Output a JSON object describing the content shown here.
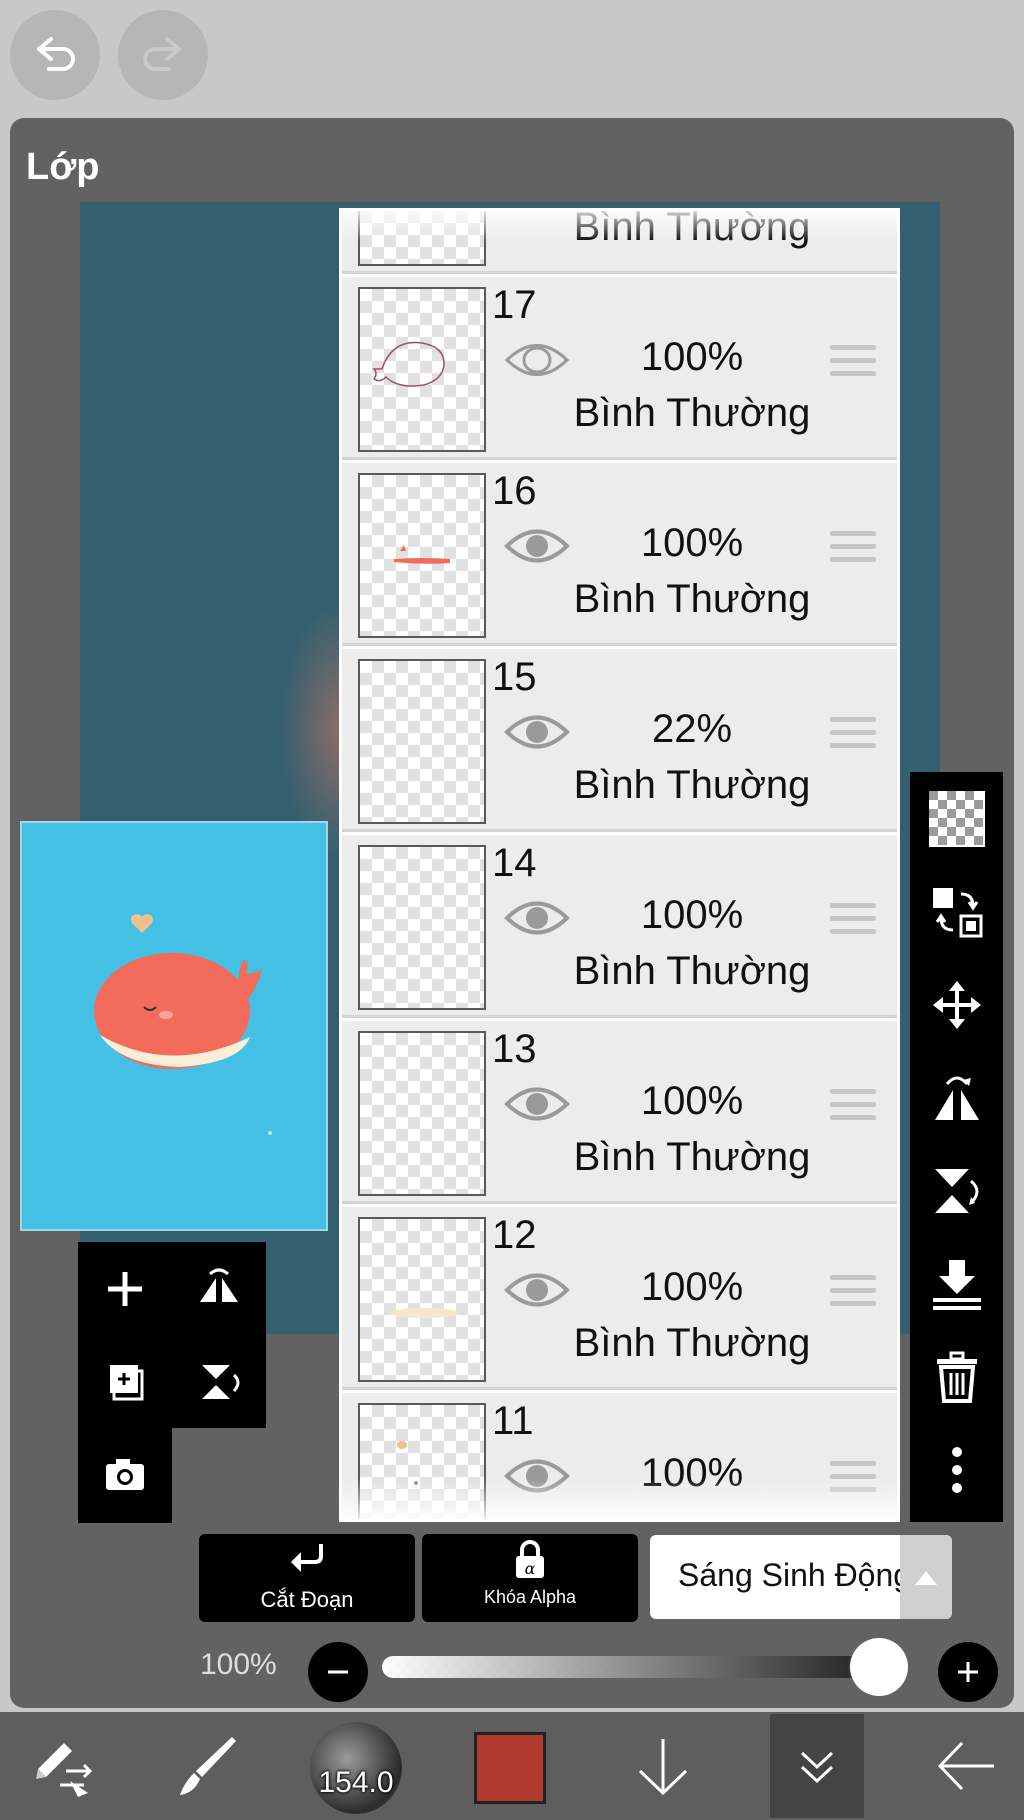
{
  "panel": {
    "title": "Lớp"
  },
  "layers": [
    {
      "num": "",
      "opacity": "",
      "blend": "Bình Thường",
      "visible": true
    },
    {
      "num": "17",
      "opacity": "100%",
      "blend": "Bình Thường",
      "visible": false
    },
    {
      "num": "16",
      "opacity": "100%",
      "blend": "Bình Thường",
      "visible": true
    },
    {
      "num": "15",
      "opacity": "22%",
      "blend": "Bình Thường",
      "visible": true
    },
    {
      "num": "14",
      "opacity": "100%",
      "blend": "Bình Thường",
      "visible": true
    },
    {
      "num": "13",
      "opacity": "100%",
      "blend": "Bình Thường",
      "visible": true
    },
    {
      "num": "12",
      "opacity": "100%",
      "blend": "Bình Thường",
      "visible": true
    },
    {
      "num": "11",
      "opacity": "100%",
      "blend": "",
      "visible": true
    }
  ],
  "actions": {
    "clipping_label": "Cắt Đoạn",
    "alpha_lock_label": "Khóa Alpha",
    "blend_mode": "Sáng Sinh Động"
  },
  "opacity_slider": {
    "label": "100%",
    "value": 1.0
  },
  "toolbar": {
    "brush_size": "154.0",
    "color": "#b03a2e"
  },
  "icons": [
    "undo-icon",
    "redo-icon",
    "add-layer-icon",
    "flip-horizontal-icon",
    "copy-layer-icon",
    "flip-vertical-icon",
    "camera-icon",
    "transparent-checker-icon",
    "move-layer-icon",
    "transform-move-icon",
    "rotate-flip-icon",
    "vertical-flip-icon",
    "merge-down-icon",
    "trash-icon",
    "more-icon",
    "clipping-icon",
    "alpha-lock-icon",
    "caret-up-icon",
    "minus-icon",
    "plus-icon",
    "transform-tool-icon",
    "brush-tool-icon",
    "down-arrow-icon",
    "layers-collapse-icon",
    "back-arrow-icon"
  ]
}
